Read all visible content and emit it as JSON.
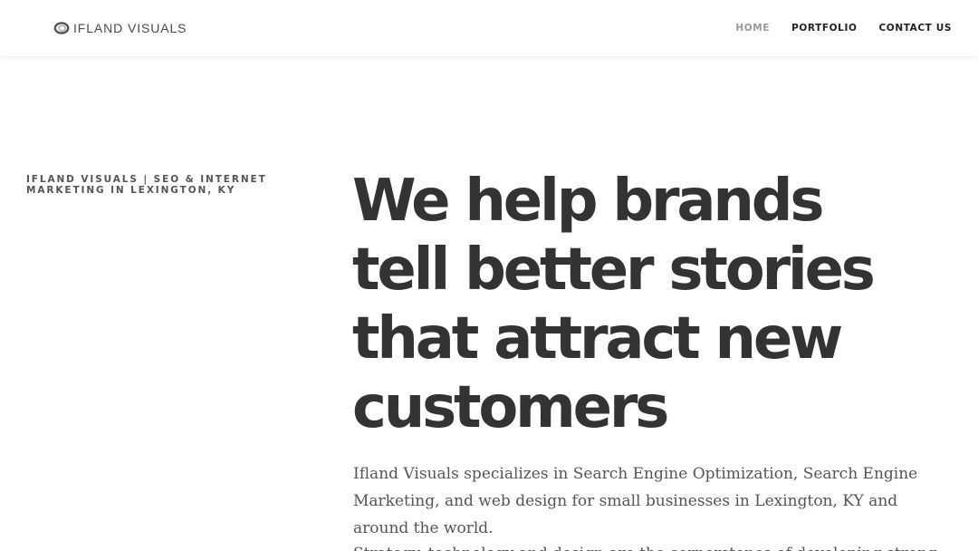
{
  "header": {
    "logo_text": "IFLAND VISUALS",
    "logo_icon": "ring-logo-icon",
    "nav": [
      {
        "label": "HOME",
        "active": true
      },
      {
        "label": "PORTFOLIO",
        "active": false
      },
      {
        "label": "CONTACT US",
        "active": false
      }
    ]
  },
  "hero": {
    "eyebrow": "IFLAND VISUALS | SEO & INTERNET MARKETING IN LEXINGTON, KY",
    "title": "We help brands tell better stories that attract new customers",
    "description": "Ifland Visuals specializes in Search Engine Optimization, Search Engine Marketing, and web design for small businesses in Lexington, KY and around the world.",
    "description_2": "Strategy, technology and design are the cornerstones of developing strong user"
  },
  "colors": {
    "heading": "#333333",
    "body_text": "#555555",
    "nav_active": "#999999",
    "nav_link": "#222222"
  }
}
